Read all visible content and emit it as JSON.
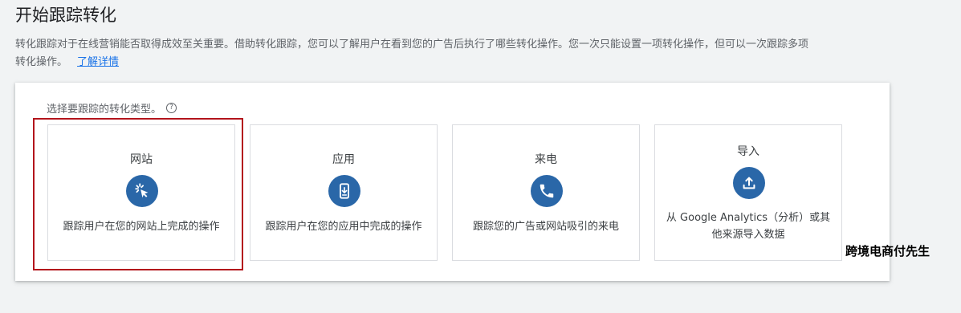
{
  "page": {
    "title": "开始跟踪转化",
    "description_line1": "转化跟踪对于在线营销能否取得成效至关重要。借助转化跟踪，您可以了解用户在看到您的广告后执行了哪些转化操作。您一次只能设置一项转化操作，但可以一次跟踪多项",
    "description_line2": "转化操作。",
    "learn_more": "了解详情"
  },
  "panel": {
    "prompt": "选择要跟踪的转化类型。",
    "help_glyph": "?",
    "cards": [
      {
        "title": "网站",
        "icon": "cursor-click-icon",
        "description": "跟踪用户在您的网站上完成的操作"
      },
      {
        "title": "应用",
        "icon": "mobile-app-icon",
        "description": "跟踪用户在您的应用中完成的操作"
      },
      {
        "title": "来电",
        "icon": "phone-icon",
        "description": "跟踪您的广告或网站吸引的来电"
      },
      {
        "title": "导入",
        "icon": "upload-icon",
        "description": "从 Google Analytics（分析）或其他来源导入数据"
      }
    ]
  },
  "watermark": "跨境电商付先生",
  "colors": {
    "icon_circle": "#2a67a8",
    "link": "#1a73e8",
    "highlight": "#b3141c"
  }
}
